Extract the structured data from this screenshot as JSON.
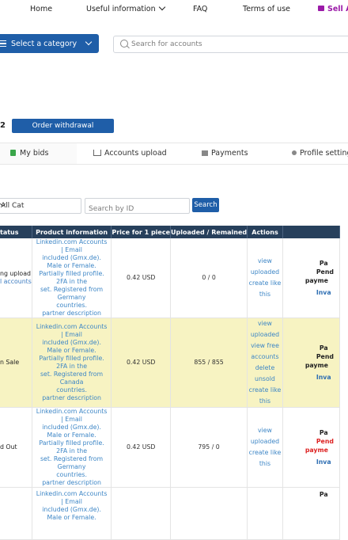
{
  "nav": {
    "home": "Home",
    "useful": "Useful information",
    "faq": "FAQ",
    "terms": "Terms of use",
    "sell": "Sell A"
  },
  "category_button": "Select a category",
  "search_placeholder": "Search for accounts",
  "balance_number": "2",
  "order_withdrawal": "Order withdrawal",
  "tabs": [
    "My bids",
    "Accounts upload",
    "Payments",
    "Profile settings"
  ],
  "filter": {
    "select_value": "All Cat",
    "id_placeholder": "Search by ID",
    "search_button": "Search"
  },
  "table": {
    "headers": [
      "tatus",
      "Product information",
      "Price for 1 piece",
      "Uploaded / Remained",
      "Actions",
      ""
    ],
    "rows": [
      {
        "status": [
          "ng upload",
          "l accounts"
        ],
        "info": [
          "Linkedin.com Accounts | Email",
          "included (Gmx.de). Male or Female.",
          "Partially filled profile. 2FA in the",
          "set. Registered from Germany",
          "countries.",
          "partner description"
        ],
        "price": "0.42 USD",
        "uploaded": "0 / 0",
        "actions": [
          "view uploaded",
          "create like this"
        ],
        "pay": [
          "Pa",
          "Pend",
          "payme",
          "Inva"
        ],
        "highlight": false,
        "pay_red": false
      },
      {
        "status": [
          "n Sale"
        ],
        "info": [
          "Linkedin.com Accounts | Email",
          "included (Gmx.de). Male or Female.",
          "Partially filled profile. 2FA in the",
          "set. Registered from Canada",
          "countries.",
          "partner description"
        ],
        "price": "0.42 USD",
        "uploaded": "855 / 855",
        "actions": [
          "view uploaded",
          "view free accounts",
          "delete unsold",
          "create like this"
        ],
        "pay": [
          "Pa",
          "Pend",
          "payme",
          "Inva"
        ],
        "highlight": true,
        "pay_red": false
      },
      {
        "status": [
          "d Out"
        ],
        "info": [
          "Linkedin.com Accounts | Email",
          "included (Gmx.de). Male or Female.",
          "Partially filled profile. 2FA in the",
          "set. Registered from Germany",
          "countries.",
          "partner description"
        ],
        "price": "0.42 USD",
        "uploaded": "795 / 0",
        "actions": [
          "view uploaded",
          "create like this"
        ],
        "pay": [
          "Pa",
          "Pend",
          "payme",
          "Inva"
        ],
        "highlight": false,
        "pay_red": true
      },
      {
        "status": [],
        "info": [
          "Linkedin.com Accounts | Email",
          "included (Gmx.de). Male or Female."
        ],
        "price": "",
        "uploaded": "",
        "actions": [],
        "pay": [
          "Pa"
        ],
        "highlight": false,
        "pay_red": false
      }
    ]
  },
  "colors": {
    "primary": "#1f5ea8",
    "header": "#27405c",
    "highlight": "#f7f3c2",
    "link": "#3d86c6",
    "sell": "#9b1aa8"
  }
}
